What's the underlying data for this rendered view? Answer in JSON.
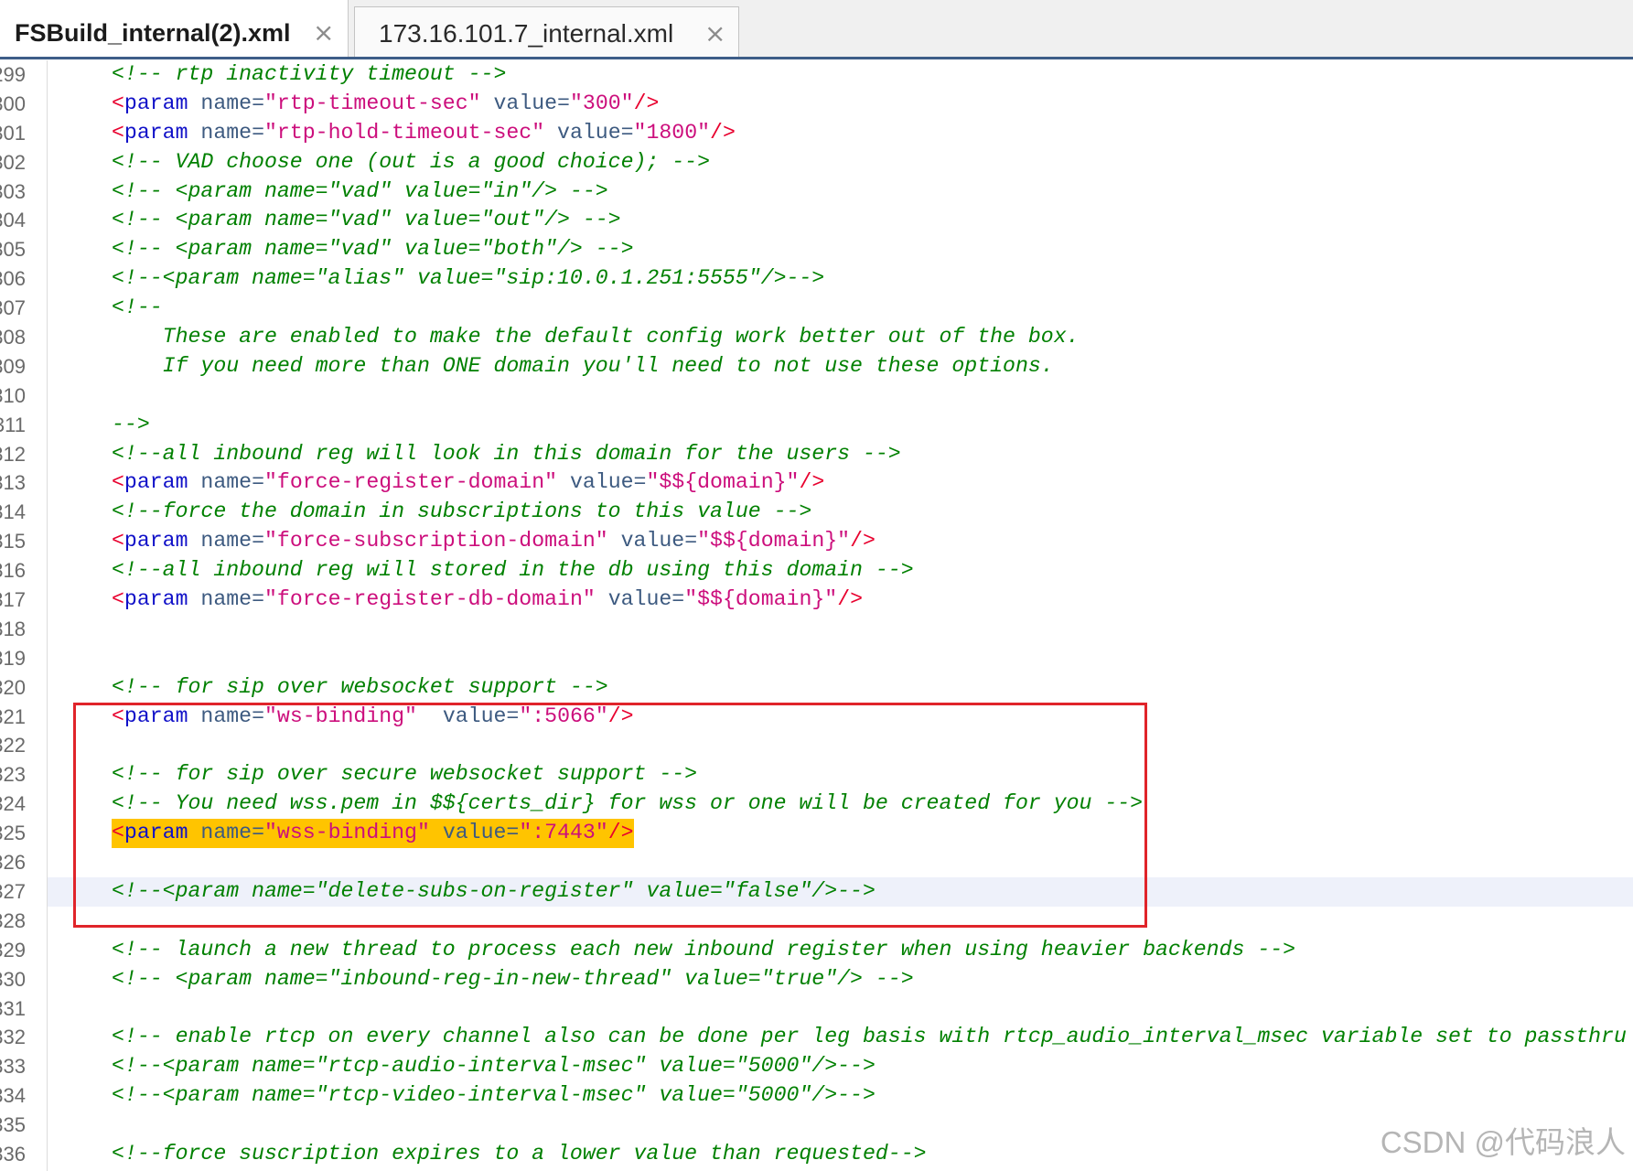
{
  "tabs": [
    {
      "label": "FSBuild_internal(2).xml",
      "active": true,
      "close_icon": "close-icon",
      "close_glyph": "×"
    },
    {
      "label": "173.16.101.7_internal.xml",
      "active": false,
      "close_icon": "close-icon",
      "close_glyph": "×"
    }
  ],
  "editor": {
    "lines": [
      {
        "number": "299",
        "kind": "comment",
        "text": "<!-- rtp inactivity timeout -->"
      },
      {
        "number": "300",
        "kind": "tag",
        "text": "<param name=\"rtp-timeout-sec\" value=\"300\"/>"
      },
      {
        "number": "301",
        "kind": "tag",
        "text": "<param name=\"rtp-hold-timeout-sec\" value=\"1800\"/>"
      },
      {
        "number": "302",
        "kind": "comment",
        "text": "<!-- VAD choose one (out is a good choice); -->"
      },
      {
        "number": "303",
        "kind": "comment",
        "text": "<!-- <param name=\"vad\" value=\"in\"/> -->"
      },
      {
        "number": "304",
        "kind": "comment",
        "text": "<!-- <param name=\"vad\" value=\"out\"/> -->"
      },
      {
        "number": "305",
        "kind": "comment",
        "text": "<!-- <param name=\"vad\" value=\"both\"/> -->"
      },
      {
        "number": "306",
        "kind": "comment",
        "text": "<!--<param name=\"alias\" value=\"sip:10.0.1.251:5555\"/>-->"
      },
      {
        "number": "307",
        "kind": "comment",
        "text": "<!--"
      },
      {
        "number": "308",
        "kind": "comment",
        "text": "    These are enabled to make the default config work better out of the box."
      },
      {
        "number": "309",
        "kind": "comment",
        "text": "    If you need more than ONE domain you'll need to not use these options."
      },
      {
        "number": "310",
        "kind": "blank",
        "text": ""
      },
      {
        "number": "311",
        "kind": "comment",
        "text": "-->"
      },
      {
        "number": "312",
        "kind": "comment",
        "text": "<!--all inbound reg will look in this domain for the users -->"
      },
      {
        "number": "313",
        "kind": "tag",
        "text": "<param name=\"force-register-domain\" value=\"$${domain}\"/>"
      },
      {
        "number": "314",
        "kind": "comment",
        "text": "<!--force the domain in subscriptions to this value -->"
      },
      {
        "number": "315",
        "kind": "tag",
        "text": "<param name=\"force-subscription-domain\" value=\"$${domain}\"/>"
      },
      {
        "number": "316",
        "kind": "comment",
        "text": "<!--all inbound reg will stored in the db using this domain -->"
      },
      {
        "number": "317",
        "kind": "tag",
        "text": "<param name=\"force-register-db-domain\" value=\"$${domain}\"/>"
      },
      {
        "number": "318",
        "kind": "blank",
        "text": ""
      },
      {
        "number": "319",
        "kind": "blank",
        "text": ""
      },
      {
        "number": "320",
        "kind": "comment",
        "text": "<!-- for sip over websocket support -->"
      },
      {
        "number": "321",
        "kind": "tag",
        "text": "<param name=\"ws-binding\"  value=\":5066\"/>"
      },
      {
        "number": "322",
        "kind": "blank",
        "text": ""
      },
      {
        "number": "323",
        "kind": "comment",
        "text": "<!-- for sip over secure websocket support -->"
      },
      {
        "number": "324",
        "kind": "comment",
        "text": "<!-- You need wss.pem in $${certs_dir} for wss or one will be created for you -->"
      },
      {
        "number": "325",
        "kind": "tag",
        "text": "<param name=\"wss-binding\" value=\":7443\"/>",
        "marked": true
      },
      {
        "number": "326",
        "kind": "blank",
        "text": ""
      },
      {
        "number": "327",
        "kind": "comment",
        "text": "<!--<param name=\"delete-subs-on-register\" value=\"false\"/>-->",
        "current": true
      },
      {
        "number": "328",
        "kind": "blank",
        "text": ""
      },
      {
        "number": "329",
        "kind": "comment",
        "text": "<!-- launch a new thread to process each new inbound register when using heavier backends -->"
      },
      {
        "number": "330",
        "kind": "comment",
        "text": "<!-- <param name=\"inbound-reg-in-new-thread\" value=\"true\"/> -->"
      },
      {
        "number": "331",
        "kind": "blank",
        "text": ""
      },
      {
        "number": "332",
        "kind": "comment",
        "text": "<!-- enable rtcp on every channel also can be done per leg basis with rtcp_audio_interval_msec variable set to passthru"
      },
      {
        "number": "333",
        "kind": "comment",
        "text": "<!--<param name=\"rtcp-audio-interval-msec\" value=\"5000\"/>-->"
      },
      {
        "number": "334",
        "kind": "comment",
        "text": "<!--<param name=\"rtcp-video-interval-msec\" value=\"5000\"/>-->"
      },
      {
        "number": "335",
        "kind": "blank",
        "text": ""
      },
      {
        "number": "336",
        "kind": "comment",
        "text": "<!--force suscription expires to a lower value than requested-->"
      }
    ]
  },
  "watermark": {
    "text": "CSDN @代码浪人"
  },
  "colors": {
    "comment": "#008000",
    "tag_bracket": "#e8002e",
    "tag_name": "#1010c8",
    "attribute_name": "#3d5a80",
    "attribute_value": "#cc0e7c",
    "mark_bg": "#ffc400",
    "current_line_bg": "#eef1fa",
    "annotation_box": "#e0242a"
  }
}
